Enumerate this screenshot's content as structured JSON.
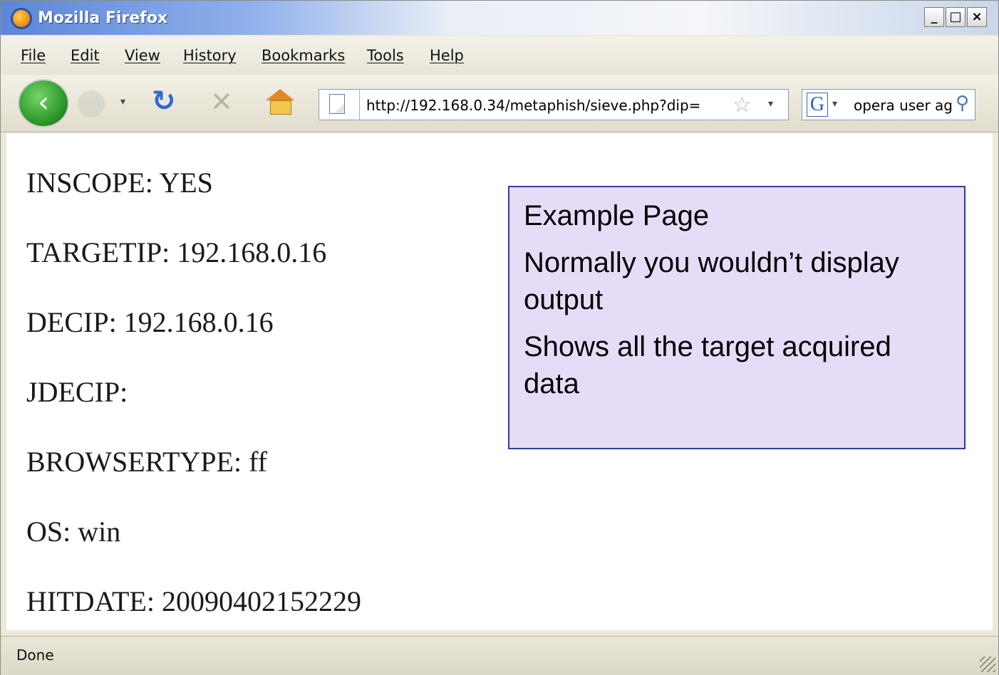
{
  "window": {
    "title": "Mozilla Firefox",
    "controls": {
      "minimize": "_",
      "maximize": "□",
      "close": "×"
    }
  },
  "menu": {
    "items": [
      "File",
      "Edit",
      "View",
      "History",
      "Bookmarks",
      "Tools",
      "Help"
    ]
  },
  "toolbar": {
    "back_icon": "back-arrow-icon",
    "reload_icon": "reload-icon",
    "stop_icon": "stop-icon",
    "home_icon": "home-icon",
    "url": "http://192.168.0.34/metaphish/sieve.php?dip=",
    "search_engine_letter": "G",
    "search_value": "opera user ag",
    "bookmark_star": "☆",
    "dropdown": "▾"
  },
  "page": {
    "lines": [
      "INSCOPE: YES",
      "TARGETIP: 192.168.0.16",
      "DECIP: 192.168.0.16",
      "JDECIP:",
      "BROWSERTYPE: ff",
      "OS: win",
      "HITDATE: 20090402152229"
    ]
  },
  "callout": {
    "heading": "Example Page",
    "line1": "Normally you wouldn’t display output",
    "line2": "Shows all the target acquired data",
    "background": "#e7dcf7",
    "border": "#2b3fa0"
  },
  "status": {
    "text": "Done"
  }
}
